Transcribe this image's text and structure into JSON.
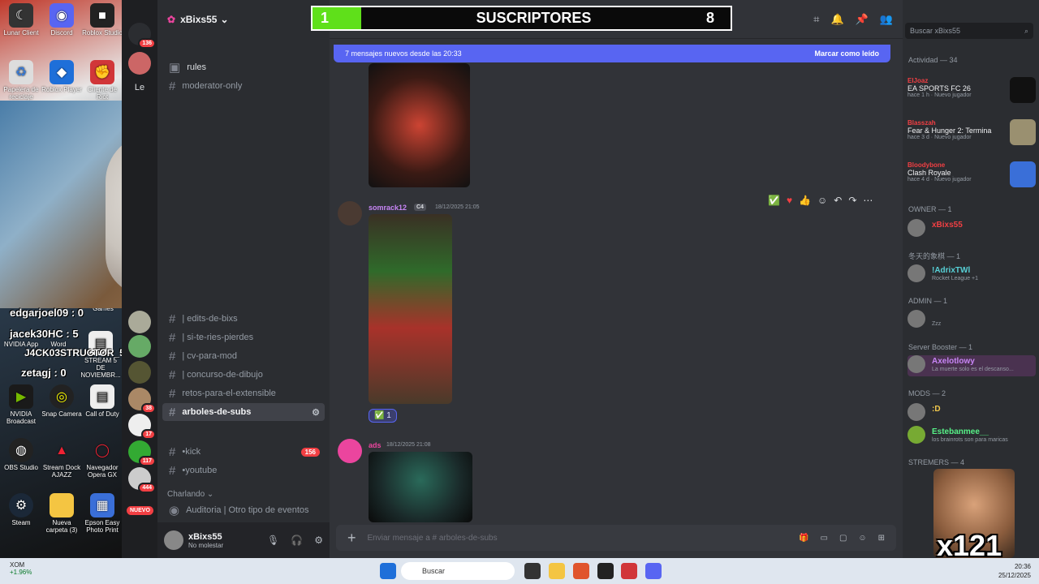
{
  "overlay": {
    "sub_current": "1",
    "sub_label": "SUSCRIPTORES",
    "sub_goal": "8",
    "sub_progress": 0.125,
    "chat_lines": [
      "edgarjoel09 : 0",
      "jacek30HC : 5",
      "J4CK03STRUCTOR_5 0 : 00",
      "zetagj : 0"
    ],
    "emote_count": "x121"
  },
  "desktop": {
    "icons": [
      "Lunar Client",
      "Discord",
      "Roblox Studio",
      "Papelera de reciclaje",
      "Roblox Player",
      "Cliente de Riot",
      "NVIDIA App",
      "Word",
      "STREAM 5 DE NOVIEMBR...",
      "NVIDIA Broadcast",
      "Snap Camera",
      "Call of Duty",
      "OBS Studio",
      "Stream Dock AJAZZ",
      "Navegador Opera GX",
      "Steam",
      "Nueva carpeta (3)",
      "Epson Easy Photo Print",
      "Games"
    ]
  },
  "rail": {
    "badges": [
      "136",
      "51",
      "38",
      "17",
      "117",
      "444"
    ],
    "nuevo": "NUEVO",
    "le": "Le"
  },
  "server": {
    "name": "xBixs55"
  },
  "channels": {
    "top": [
      {
        "label": "rules"
      },
      {
        "label": "moderator-only"
      }
    ],
    "list": [
      {
        "label": "| edits-de-bixs"
      },
      {
        "label": "| si-te-ries-pierdes"
      },
      {
        "label": "| cv-para-mod"
      },
      {
        "label": "| concurso-de-dibujo"
      },
      {
        "label": "retos-para-el-extensible"
      },
      {
        "label": "arboles-de-subs"
      }
    ],
    "lower": [
      {
        "label": "•kick",
        "badge": "156"
      },
      {
        "label": "•youtube"
      }
    ],
    "category_voice": "Charlando",
    "voice_channel": "Auditoria | Otro tipo de eventos"
  },
  "user_panel": {
    "name": "xBixs55",
    "status": "No molestar"
  },
  "main": {
    "channel": "arboles-de-subs",
    "new_messages": "7 mensajes nuevos desde las 20:33",
    "mark_read": "Marcar como leído",
    "messages": [
      {
        "author": "somrack12",
        "tag": "C4",
        "time": "18/12/2025 21:05",
        "reaction_count": "1"
      },
      {
        "author": "ads",
        "time": "18/12/2025 21:08"
      }
    ],
    "composer_placeholder": "Enviar mensaje a # arboles-de-subs"
  },
  "activity": {
    "search_placeholder": "Buscar xBixs55",
    "header": "Actividad — 34",
    "games": [
      {
        "user": "ElJoaz",
        "title": "EA SPORTS FC 26",
        "meta": "hace 1 h · Nuevo jugador"
      },
      {
        "user": "Blasszah",
        "title": "Fear & Hunger 2: Termina",
        "meta": "hace 3 d · Nuevo jugador"
      },
      {
        "user": "Bloodybone",
        "title": "Clash Royale",
        "meta": "hace 4 d · Nuevo jugador"
      }
    ],
    "groups": [
      {
        "title": "OWNER — 1"
      },
      {
        "title": "冬天的象棋 — 1"
      },
      {
        "title": "ADMIN — 1"
      },
      {
        "title": "Server Booster — 1"
      },
      {
        "title": "MODS — 2"
      },
      {
        "title": "STREMERS — 4"
      }
    ],
    "members": [
      {
        "name": "xBixs55",
        "status": "",
        "tag": "x55",
        "color": "#f23f43"
      },
      {
        "name": "!AdrixTWl",
        "status": "Rocket League +1",
        "tag": "FCB",
        "color": "#57d0d6"
      },
      {
        "name": "Zzz",
        "status": "",
        "color": "#949ba4"
      },
      {
        "name": "Axelotlowy",
        "status": "La muerte solo es el descanso...",
        "color": "#c785f5"
      },
      {
        "name": ":D",
        "status": "",
        "color": "#f2c94c"
      },
      {
        "name": "Estebanmee__",
        "status": "los brainrots son para maricas",
        "tag": "EZ",
        "color": "#57f287"
      }
    ]
  },
  "taskbar": {
    "stock_name": "XOM",
    "stock_change": "+1.96%",
    "search": "Buscar",
    "time": "20:36",
    "date": "25/12/2025"
  }
}
